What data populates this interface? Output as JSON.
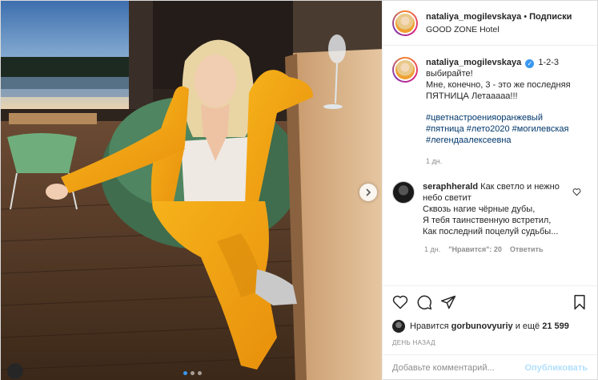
{
  "post": {
    "username": "nataliya_mogilevskaya",
    "follow_separator": "•",
    "follow_label": "Подписки",
    "location": "GOOD ZONE Hotel",
    "caption": {
      "username": "nataliya_mogilevskaya",
      "text_line1": "1-2-3 выбирайте!",
      "text_line2": "Мне, конечно, 3 - это же последняя ПЯТНИЦА Летааааа!!!",
      "hashtags": [
        "#цветнастроенияоранжевый",
        "#пятница",
        "#лето2020",
        "#могилевская",
        "#легендаалексеевна"
      ],
      "time": "1 дн."
    },
    "comment": {
      "username": "seraphherald",
      "lines": [
        "Как светло и нежно небо светит",
        "Сквозь нагие чёрные дубы,",
        "Я тебя таинственную встретил,",
        "Как последний поцелуй судьбы..."
      ],
      "time": "1 дн.",
      "likes": "\"Нравится\": 20",
      "reply": "Ответить"
    },
    "likes": {
      "prefix": "Нравится",
      "user": "gorbunovyuriy",
      "suffix": "и ещё",
      "count": "21 599"
    },
    "date": "ДЕНЬ НАЗАД",
    "comment_input": {
      "placeholder": "Добавьте комментарий..."
    },
    "publish_label": "Опубликовать",
    "carousel": {
      "slides": 3,
      "active": 1
    },
    "icons": [
      "heart-icon",
      "comment-icon",
      "share-icon",
      "bookmark-icon",
      "chevron-right-icon",
      "verified-badge-icon",
      "small-heart-icon"
    ],
    "colors": {
      "link": "#00376b",
      "accent": "#3897f0",
      "muted": "#8e8e8e",
      "publish_disabled": "#b2dffc",
      "suit_orange": "#f2a413"
    }
  }
}
